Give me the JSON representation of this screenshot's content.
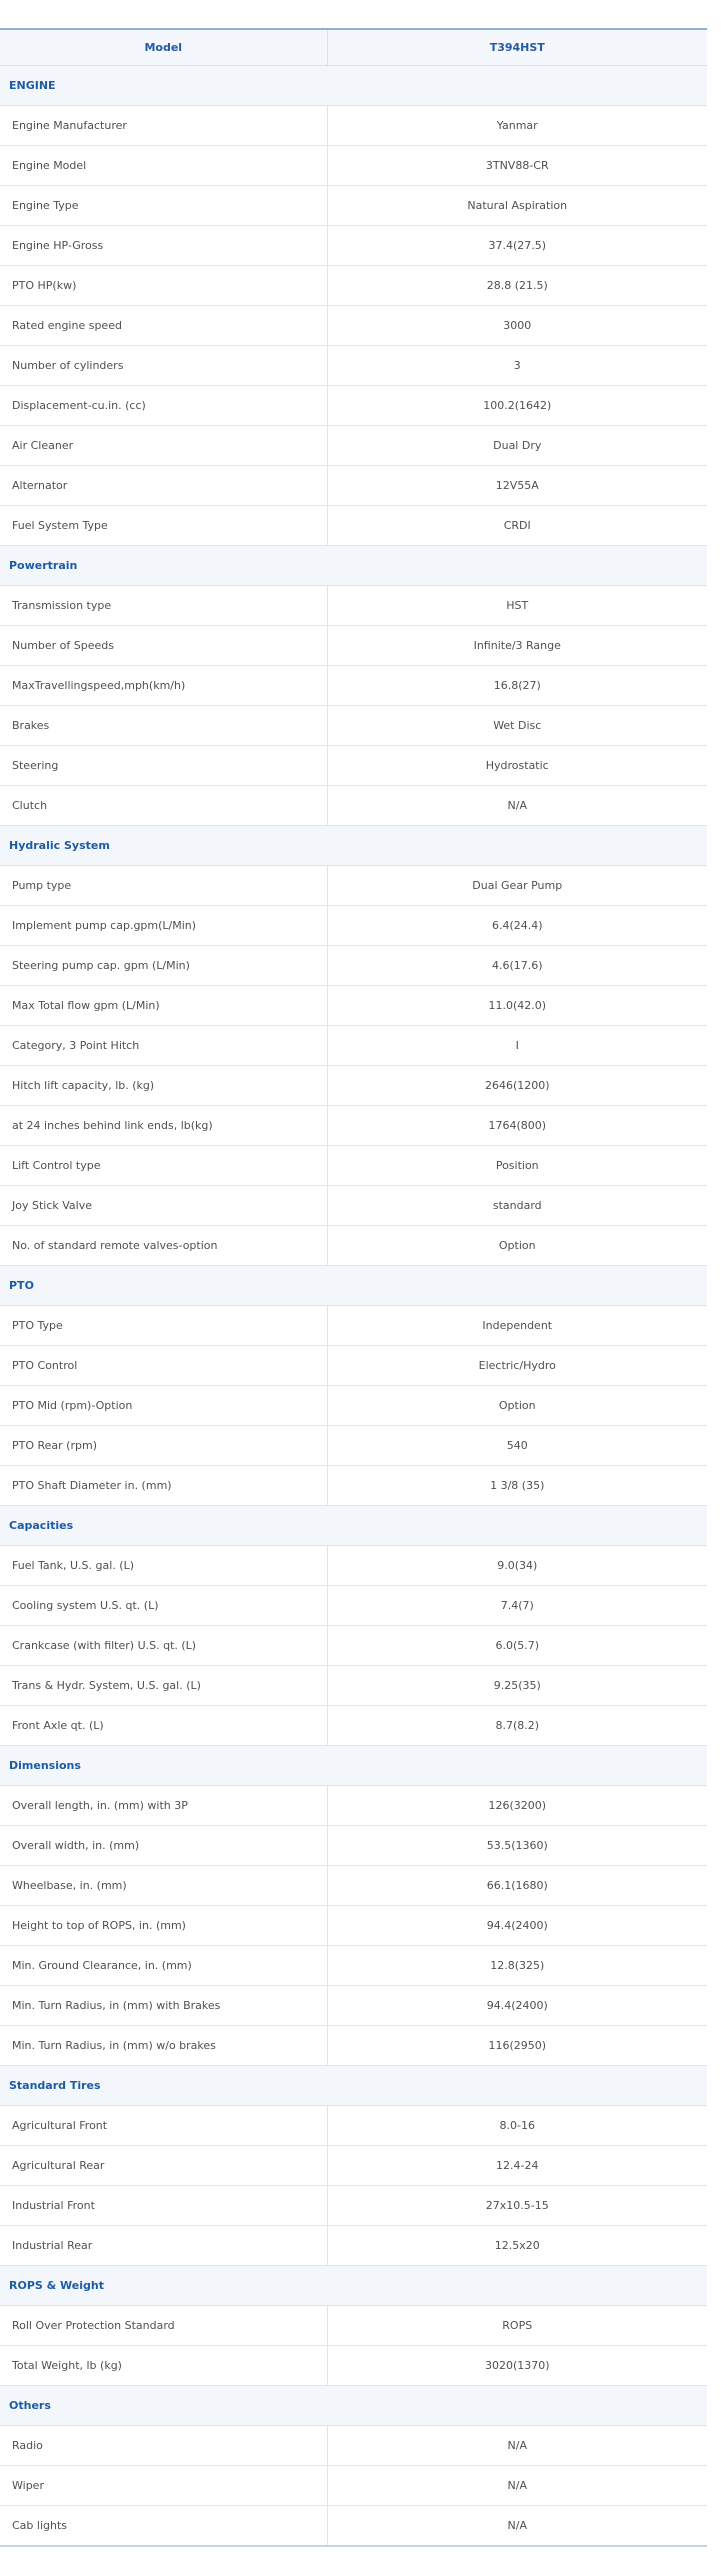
{
  "header": {
    "model_label": "Model",
    "model_value": "T394HST"
  },
  "sections": [
    {
      "title": "ENGINE",
      "rows": [
        [
          "Engine Manufacturer",
          "Yanmar"
        ],
        [
          "Engine Model",
          "3TNV88-CR"
        ],
        [
          "Engine Type",
          "Natural Aspiration"
        ],
        [
          "Engine HP-Gross",
          "37.4(27.5)"
        ],
        [
          "PTO HP(kw)",
          "28.8 (21.5)"
        ],
        [
          "Rated engine speed",
          "3000"
        ],
        [
          "Number of cylinders",
          "3"
        ],
        [
          "Displacement-cu.in. (cc)",
          "100.2(1642)"
        ],
        [
          "Air Cleaner",
          "Dual Dry"
        ],
        [
          "Alternator",
          "12V55A"
        ],
        [
          "Fuel System Type",
          "CRDI"
        ]
      ]
    },
    {
      "title": "Powertrain",
      "rows": [
        [
          "Transmission type",
          "HST"
        ],
        [
          "Number of Speeds",
          "Infinite/3 Range"
        ],
        [
          "MaxTravellingspeed,mph(km/h)",
          "16.8(27)"
        ],
        [
          "Brakes",
          "Wet Disc"
        ],
        [
          "Steering",
          "Hydrostatic"
        ],
        [
          "Clutch",
          "N/A"
        ]
      ]
    },
    {
      "title": "Hydralic System",
      "rows": [
        [
          "Pump type",
          "Dual Gear Pump"
        ],
        [
          "Implement pump cap.gpm(L/Min)",
          "6.4(24.4)"
        ],
        [
          "Steering pump cap. gpm (L/Min)",
          "4.6(17.6)"
        ],
        [
          "Max Total flow gpm (L/Min)",
          "11.0(42.0)"
        ],
        [
          "Category, 3 Point Hitch",
          "I"
        ],
        [
          "Hitch lift capacity, lb. (kg)",
          "2646(1200)"
        ],
        [
          "at 24 inches behind link ends, lb(kg)",
          "1764(800)"
        ],
        [
          "Lift Control type",
          "Position"
        ],
        [
          "Joy Stick Valve",
          "standard"
        ],
        [
          "No. of standard remote valves-option",
          "Option"
        ]
      ]
    },
    {
      "title": "PTO",
      "rows": [
        [
          "PTO Type",
          "Independent"
        ],
        [
          "PTO Control",
          "Electric/Hydro"
        ],
        [
          "PTO Mid (rpm)-Option",
          "Option"
        ],
        [
          "PTO Rear (rpm)",
          "540"
        ],
        [
          "PTO Shaft Diameter in. (mm)",
          "1 3/8 (35)"
        ]
      ]
    },
    {
      "title": "Capacities",
      "rows": [
        [
          "Fuel Tank, U.S. gal. (L)",
          "9.0(34)"
        ],
        [
          "Cooling system U.S. qt. (L)",
          "7.4(7)"
        ],
        [
          "Crankcase (with filter) U.S. qt. (L)",
          "6.0(5.7)"
        ],
        [
          "Trans & Hydr. System, U.S. gal. (L)",
          "9.25(35)"
        ],
        [
          "Front Axle qt. (L)",
          "8.7(8.2)"
        ]
      ]
    },
    {
      "title": "Dimensions",
      "rows": [
        [
          "Overall length, in. (mm) with 3P",
          "126(3200)"
        ],
        [
          "Overall width, in. (mm)",
          "53.5(1360)"
        ],
        [
          "Wheelbase, in. (mm)",
          "66.1(1680)"
        ],
        [
          "Height to top of ROPS, in. (mm)",
          "94.4(2400)"
        ],
        [
          "Min. Ground Clearance, in. (mm)",
          "12.8(325)"
        ],
        [
          "Min. Turn Radius, in (mm) with Brakes",
          "94.4(2400)"
        ],
        [
          "Min. Turn Radius, in (mm) w/o brakes",
          "116(2950)"
        ]
      ]
    },
    {
      "title": "Standard Tires",
      "rows": [
        [
          "Agricultural Front",
          "8.0-16"
        ],
        [
          "Agricultural Rear",
          "12.4-24"
        ],
        [
          "Industrial Front",
          "27x10.5-15"
        ],
        [
          "Industrial Rear",
          "12.5x20"
        ]
      ]
    },
    {
      "title": "ROPS & Weight",
      "rows": [
        [
          "Roll Over Protection Standard",
          "ROPS"
        ],
        [
          "Total Weight, lb (kg)",
          "3020(1370)"
        ]
      ]
    },
    {
      "title": "Others",
      "rows": [
        [
          "Radio",
          "N/A"
        ],
        [
          "Wiper",
          "N/A"
        ],
        [
          "Cab lights",
          "N/A"
        ]
      ]
    }
  ]
}
